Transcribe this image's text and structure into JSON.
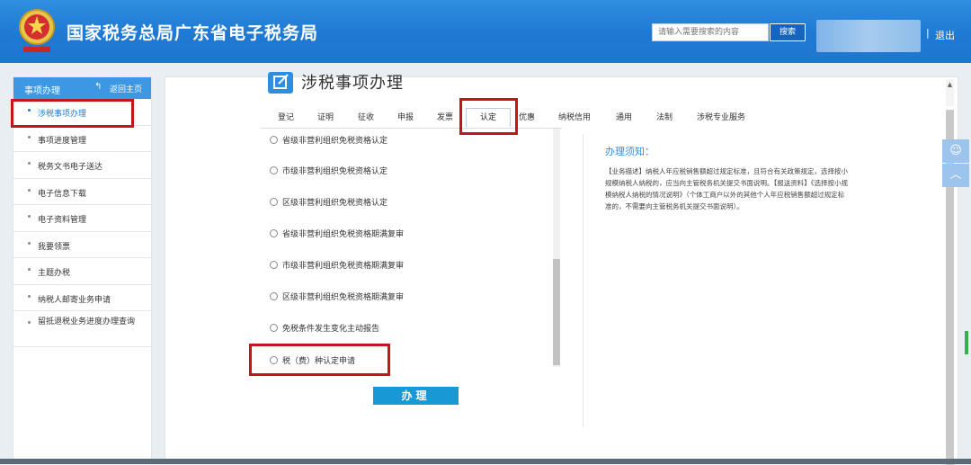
{
  "header": {
    "title": "国家税务总局广东省电子税务局",
    "search_placeholder": "请输入需要搜索的内容",
    "search_label": "搜索",
    "separator": "|",
    "logout_label": "退出"
  },
  "sidebar": {
    "title": "事项办理",
    "home_label": "返回主页",
    "items": [
      {
        "label": "涉税事项办理"
      },
      {
        "label": "事项进度管理"
      },
      {
        "label": "税务文书电子送达"
      },
      {
        "label": "电子信息下载"
      },
      {
        "label": "电子资料管理"
      },
      {
        "label": "我要领票"
      },
      {
        "label": "主题办税"
      },
      {
        "label": "纳税人邮寄业务申请"
      },
      {
        "label": "留抵退税业务进度办理查询"
      }
    ]
  },
  "main": {
    "title": "涉税事项办理",
    "tabs": [
      "登记",
      "证明",
      "征收",
      "申报",
      "发票",
      "认定",
      "优惠",
      "纳税信用",
      "通用",
      "法制",
      "涉税专业服务"
    ],
    "options": [
      "省级非营利组织免税资格认定",
      "市级非营利组织免税资格认定",
      "区级非营利组织免税资格认定",
      "省级非营利组织免税资格期满复审",
      "市级非营利组织免税资格期满复审",
      "区级非营利组织免税资格期满复审",
      "免税条件发生变化主动报告",
      "税（费）种认定申请"
    ],
    "submit_label": "办理",
    "notice_title": "办理须知：",
    "notice_body": "【业务描述】纳税人年应税销售额超过规定标准，且符合有关政策规定，选择按小规模纳税人纳税的，应当向主管税务机关提交书面说明。【报送资料】《选择按小规模纳税人纳税的情况说明》（个体工商户以外的其他个人年应税销售额超过规定标准的，不需要向主管税务机关提交书面说明）。"
  },
  "colors": {
    "header_blue": "#1f79d2",
    "accent_blue": "#2e8ee0",
    "highlight_red": "#c4151c",
    "button_blue": "#1899d6"
  }
}
